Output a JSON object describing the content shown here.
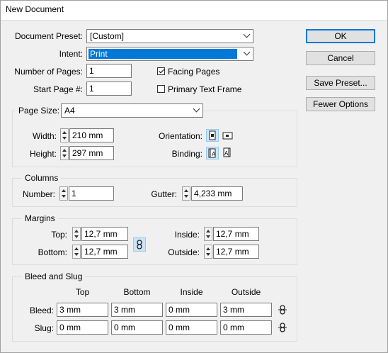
{
  "window": {
    "title": "New Document"
  },
  "preset": {
    "label": "Document Preset:",
    "value": "[Custom]"
  },
  "intent": {
    "label": "Intent:",
    "value": "Print"
  },
  "pages": {
    "number_label": "Number of Pages:",
    "number_value": "1",
    "start_label": "Start Page #:",
    "start_value": "1"
  },
  "options": {
    "facing_label": "Facing Pages",
    "facing_checked": true,
    "primary_label": "Primary Text Frame",
    "primary_checked": false
  },
  "buttons": {
    "ok": "OK",
    "cancel": "Cancel",
    "save_preset": "Save Preset...",
    "fewer_options": "Fewer Options"
  },
  "page_size": {
    "label": "Page Size:",
    "value": "A4",
    "width_label": "Width:",
    "width_value": "210 mm",
    "height_label": "Height:",
    "height_value": "297 mm",
    "orientation_label": "Orientation:",
    "binding_label": "Binding:"
  },
  "columns": {
    "title": "Columns",
    "number_label": "Number:",
    "number_value": "1",
    "gutter_label": "Gutter:",
    "gutter_value": "4,233 mm"
  },
  "margins": {
    "title": "Margins",
    "top_label": "Top:",
    "top_value": "12,7 mm",
    "bottom_label": "Bottom:",
    "bottom_value": "12,7 mm",
    "inside_label": "Inside:",
    "inside_value": "12,7 mm",
    "outside_label": "Outside:",
    "outside_value": "12,7 mm"
  },
  "bleed_slug": {
    "title": "Bleed and Slug",
    "headers": [
      "Top",
      "Bottom",
      "Inside",
      "Outside"
    ],
    "bleed_label": "Bleed:",
    "bleed_values": [
      "3 mm",
      "3 mm",
      "0 mm",
      "3 mm"
    ],
    "slug_label": "Slug:",
    "slug_values": [
      "0 mm",
      "0 mm",
      "0 mm",
      "0 mm"
    ]
  },
  "icons": {
    "orientation_portrait": "portrait-orientation-icon",
    "orientation_landscape": "landscape-orientation-icon",
    "binding_left": "left-binding-icon",
    "binding_right": "right-binding-icon",
    "chain": "chain-link-icon"
  },
  "colors": {
    "accent": "#0078d7",
    "dialog_bg": "#f0f0f0"
  }
}
